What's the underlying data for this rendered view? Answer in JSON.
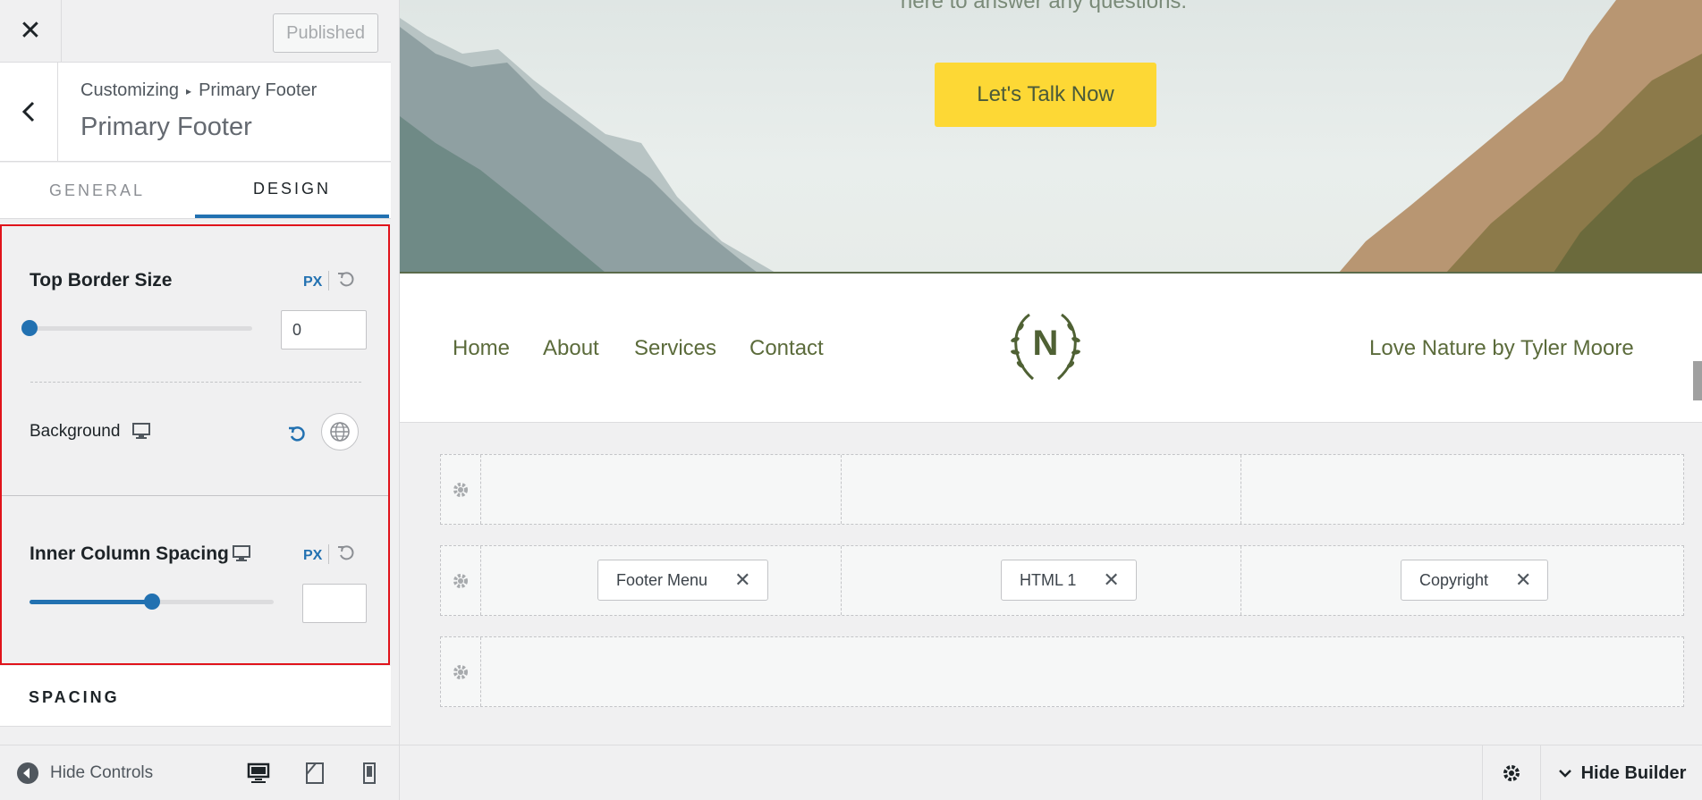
{
  "topbar": {
    "close_glyph": "✕",
    "published_label": "Published"
  },
  "header": {
    "breadcrumb_root": "Customizing",
    "breadcrumb_arrow": "▸",
    "breadcrumb_current": "Primary Footer",
    "title": "Primary Footer"
  },
  "tabs": [
    {
      "label": "GENERAL",
      "active": false
    },
    {
      "label": "DESIGN",
      "active": true
    }
  ],
  "controls": {
    "top_border": {
      "title": "Top Border Size",
      "unit": "PX",
      "value": "0",
      "slider_fraction": 0.0
    },
    "background": {
      "label": "Background"
    },
    "inner_spacing": {
      "title": "Inner Column Spacing",
      "unit": "PX",
      "value": "",
      "slider_fraction": 0.5
    }
  },
  "spacing_section": {
    "label": "SPACING"
  },
  "bottom_bar": {
    "hide_controls_label": "Hide Controls"
  },
  "preview": {
    "hero_text": "here to answer any questions.",
    "cta_label": "Let's Talk Now",
    "nav": [
      "Home",
      "About",
      "Services",
      "Contact"
    ],
    "logo_letter": "N",
    "credit": "Love Nature by Tyler Moore"
  },
  "builder": {
    "chips": [
      "Footer Menu",
      "HTML 1",
      "Copyright"
    ],
    "chip_close_glyph": "✕",
    "hide_builder_label": "Hide Builder"
  },
  "colors": {
    "accent": "#2271b1",
    "highlight_border": "#e0131b",
    "cta": "#fdd835",
    "brand_green": "#5b6b3b"
  }
}
